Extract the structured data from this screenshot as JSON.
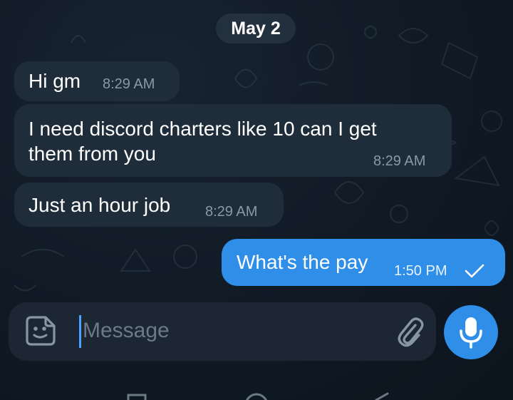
{
  "chat": {
    "date_label": "May 2",
    "messages": [
      {
        "direction": "incoming",
        "text": "Hi gm",
        "time": "8:29 AM"
      },
      {
        "direction": "incoming",
        "text_lines": [
          "I need discord charters like 10 can I get",
          "them from you"
        ],
        "time": "8:29 AM"
      },
      {
        "direction": "incoming",
        "text": "Just an hour job",
        "time": "8:29 AM"
      },
      {
        "direction": "outgoing",
        "text": "What's the pay",
        "time": "1:50 PM",
        "status": "sent"
      }
    ]
  },
  "composer": {
    "placeholder": "Message",
    "value": "",
    "icons": {
      "sticker": "sticker-icon",
      "attach": "paperclip-icon",
      "mic": "microphone-icon"
    }
  },
  "colors": {
    "outgoing_bubble": "#2f8ee8",
    "incoming_bubble": "#1f2c39",
    "background": "#0f1823",
    "accent": "#2f8ee8"
  }
}
